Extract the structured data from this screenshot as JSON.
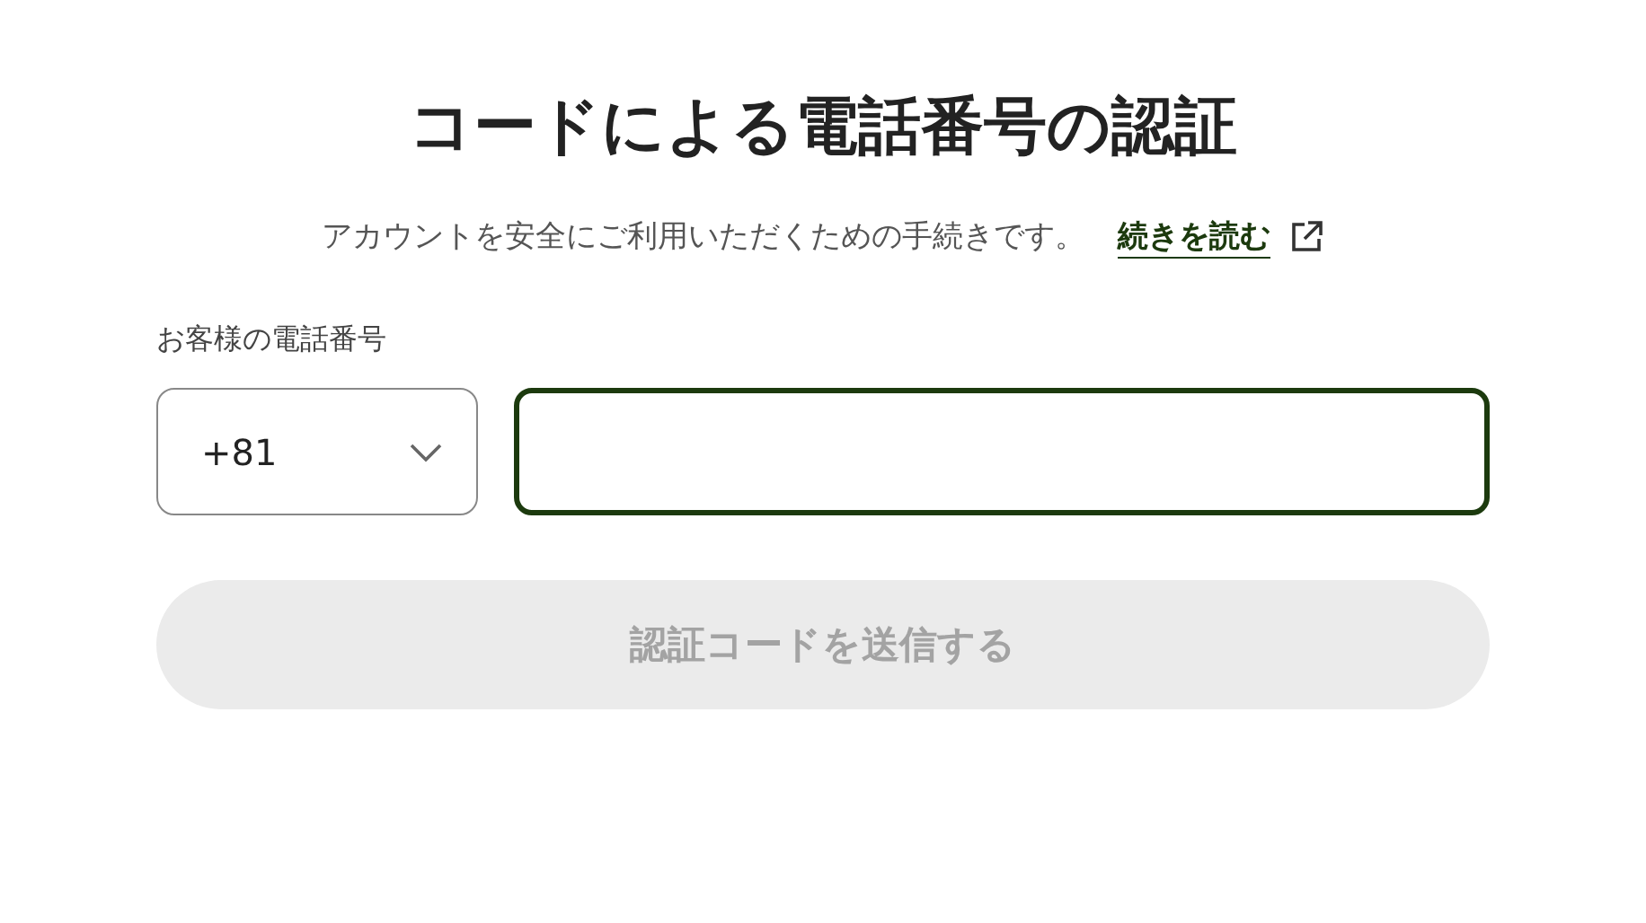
{
  "title": "コードによる電話番号の認証",
  "description": {
    "text": "アカウントを安全にご利用いただくための手続きです。",
    "link": "続きを読む"
  },
  "phone": {
    "label": "お客様の電話番号",
    "country_code": "+81",
    "focused": true
  },
  "submit_button": {
    "label": "認証コードを送信する",
    "disabled": true
  }
}
